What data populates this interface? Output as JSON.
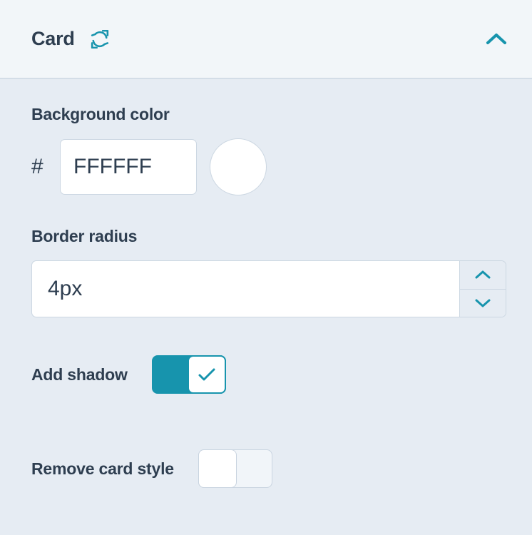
{
  "header": {
    "title": "Card",
    "reset_icon": "refresh-sync-icon",
    "collapse_icon": "chevron-up-icon"
  },
  "theme": {
    "accent": "#1794ad",
    "text": "#2e3e50",
    "body_bg": "#e6ecf3",
    "header_bg": "#f2f6f9",
    "border": "#ccd7e2",
    "input_bg": "#ffffff"
  },
  "fields": {
    "background_color": {
      "label": "Background color",
      "prefix": "#",
      "value": "FFFFFF",
      "placeholder": "FFFFFF",
      "swatch_color": "#FFFFFF"
    },
    "border_radius": {
      "label": "Border radius",
      "value": "4px",
      "placeholder": "4px",
      "increment_icon": "chevron-up-icon",
      "decrement_icon": "chevron-down-icon"
    },
    "add_shadow": {
      "label": "Add shadow",
      "state": "on",
      "knob_icon": "check-icon"
    },
    "remove_card_style": {
      "label": "Remove card style",
      "state": "off",
      "knob_icon": ""
    }
  }
}
